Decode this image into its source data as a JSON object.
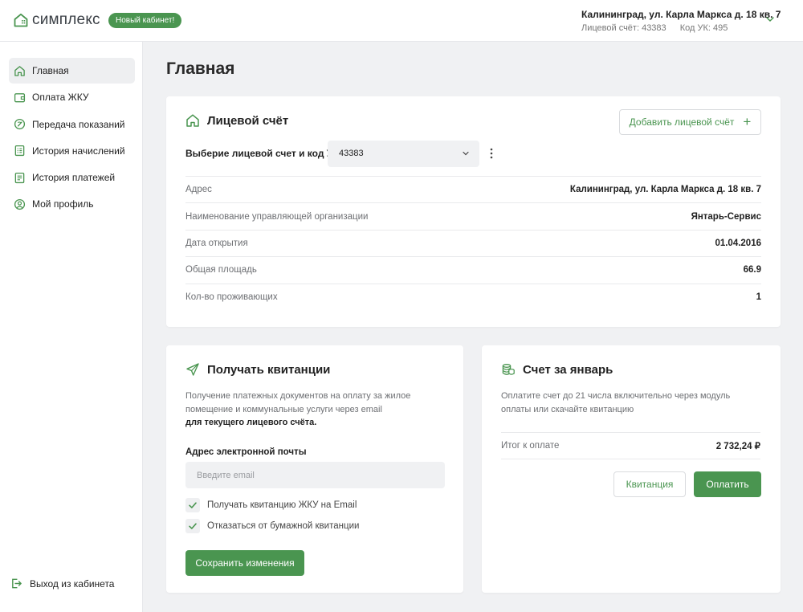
{
  "header": {
    "logo_text": "симплекс",
    "badge": "Новый кабинет!",
    "account_address": "Калининград, ул. Карла Маркса д. 18 кв. 7",
    "account_label": "Лицевой счёт:  43383",
    "uk_label": "Код УК:  495"
  },
  "sidebar": {
    "items": [
      {
        "label": "Главная",
        "icon": "home-icon"
      },
      {
        "label": "Оплата ЖКУ",
        "icon": "wallet-icon"
      },
      {
        "label": "Передача показаний",
        "icon": "meter-icon"
      },
      {
        "label": "История начислений",
        "icon": "document-icon"
      },
      {
        "label": "История платежей",
        "icon": "receipt-icon"
      },
      {
        "label": "Мой профиль",
        "icon": "user-icon"
      }
    ],
    "logout_label": "Выход из кабинета"
  },
  "main": {
    "title": "Главная",
    "account_card": {
      "title": "Лицевой счёт",
      "add_button": "Добавить лицевой счёт",
      "select_label": "Выберие лицевой счет и код УК",
      "select_value": "43383",
      "rows": [
        {
          "key": "Адрес",
          "value": "Калининград, ул. Карла Маркса д. 18 кв. 7"
        },
        {
          "key": "Наименование управляющей организации",
          "value": "Янтарь-Сервис"
        },
        {
          "key": "Дата открытия",
          "value": "01.04.2016"
        },
        {
          "key": "Общая площадь",
          "value": "66.9"
        },
        {
          "key": "Кол-во проживающих",
          "value": "1"
        }
      ]
    },
    "receipts_card": {
      "title": "Получать квитанции",
      "description": "Получение платежных документов на оплату за жилое помещение и коммунальные услуги через email",
      "description_bold": "для текущего лицевого счёта.",
      "email_label": "Адрес электронной почты",
      "email_placeholder": "Введите email",
      "email_value": "",
      "checkboxes": [
        {
          "label": "Получать квитанцию ЖКУ на Email",
          "checked": true
        },
        {
          "label": "Отказаться от бумажной квитанции",
          "checked": true
        }
      ],
      "save_button": "Сохранить изменения"
    },
    "bill_card": {
      "title": "Счет за январь",
      "description": "Оплатите счет до 21 числа включительно через модуль оплаты или скачайте квитанцию",
      "total_label": "Итог к оплате",
      "total_value": "2 732,24 ₽",
      "receipt_button": "Квитанция",
      "pay_button": "Оплатить"
    }
  },
  "colors": {
    "accent": "#4a9550",
    "background": "#f0f1f3"
  }
}
